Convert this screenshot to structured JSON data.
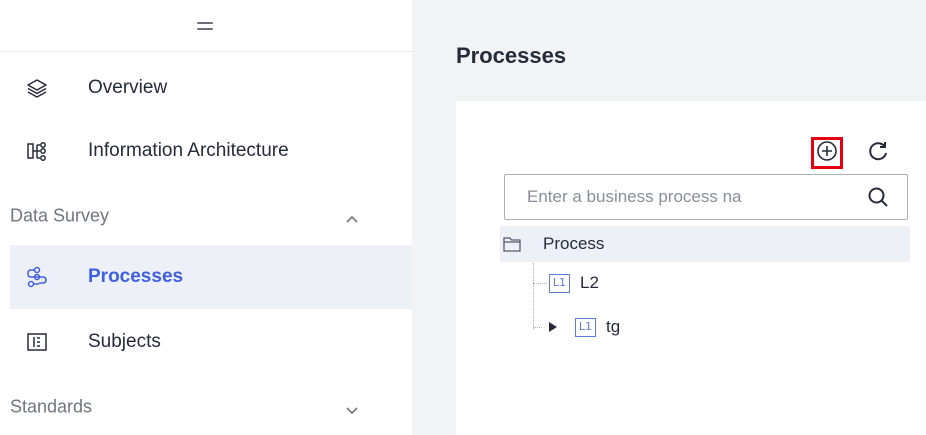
{
  "sidebar": {
    "items": [
      {
        "label": "Overview",
        "icon": "layers-icon"
      },
      {
        "label": "Information Architecture",
        "icon": "architecture-icon"
      },
      {
        "label": "Data Survey",
        "icon": "chevron-up-icon"
      },
      {
        "label": "Processes",
        "icon": "process-flow-icon"
      },
      {
        "label": "Subjects",
        "icon": "subject-icon"
      },
      {
        "label": "Standards",
        "icon": "chevron-down-icon"
      }
    ],
    "active_item": "Processes"
  },
  "main": {
    "title": "Processes",
    "search": {
      "placeholder": "Enter a business process na",
      "value": ""
    },
    "toolbar": {
      "add_icon": "add-circle-icon",
      "refresh_icon": "refresh-icon"
    },
    "tree": {
      "root": {
        "label": "Process",
        "icon": "folder-icon"
      },
      "nodes": [
        {
          "badge": "L1",
          "label": "L2",
          "expandable": false
        },
        {
          "badge": "L1",
          "label": "tg",
          "expandable": true
        }
      ]
    }
  },
  "colors": {
    "accent": "#3e5fe2",
    "highlight_border": "#e60012",
    "active_bg": "#eef0f8",
    "badge": "#5e7ce0"
  }
}
